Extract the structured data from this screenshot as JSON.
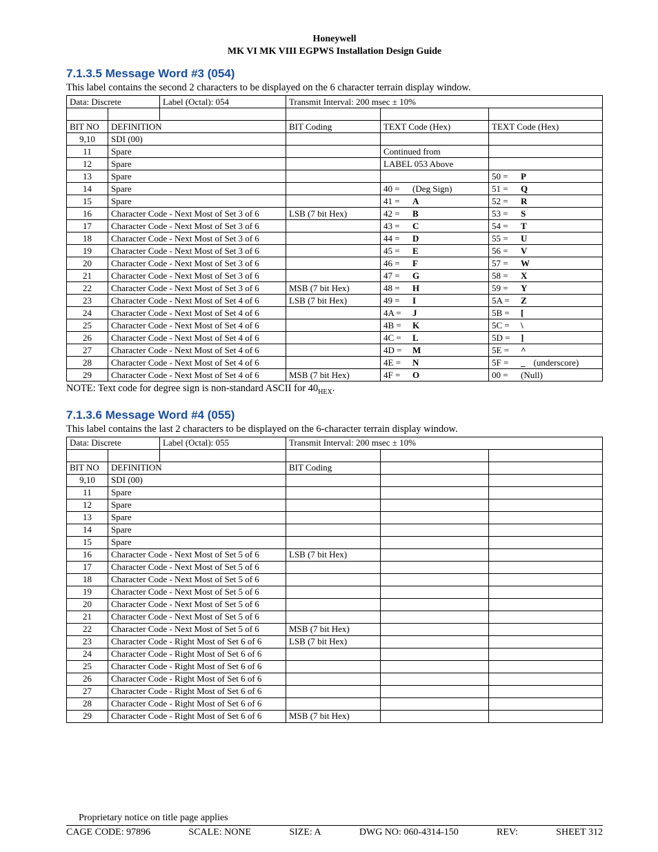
{
  "header": {
    "company": "Honeywell",
    "doc_title": "MK VI  MK VIII EGPWS Installation Design Guide"
  },
  "sections": [
    {
      "heading": "7.1.3.5  Message Word #3 (054)",
      "intro": "This label contains the second 2 characters to be displayed on the 6 character terrain display window.",
      "meta": {
        "data": "Data:  Discrete",
        "label_octal": "Label (Octal):  054",
        "tx_interval": "Transmit Interval:  200 msec ± 10%"
      },
      "head": {
        "bit_no": "BIT NO",
        "definition": "DEFINITION",
        "bit_coding": "BIT Coding",
        "tc1": "TEXT Code (Hex)",
        "tc2": "TEXT Code (Hex)"
      },
      "hex_intro_col4_a": "Continued from",
      "hex_intro_col4_b": "LABEL 053 Above",
      "rows": [
        {
          "bit": "9,10",
          "def": "SDI (00)",
          "coding": "",
          "c4": null,
          "c5": null
        },
        {
          "bit": "11",
          "def": "Spare",
          "coding": "",
          "c4": "__cont_a__",
          "c5": null
        },
        {
          "bit": "12",
          "def": "Spare",
          "coding": "",
          "c4": "__cont_b__",
          "c5": null
        },
        {
          "bit": "13",
          "def": "Spare",
          "coding": "",
          "c4": null,
          "c5": {
            "hex": "50 =",
            "ch": "P"
          }
        },
        {
          "bit": "14",
          "def": "Spare",
          "coding": "",
          "c4": {
            "hex": "40 =",
            "ch": "(Deg Sign)",
            "plain": true
          },
          "c5": {
            "hex": "51 =",
            "ch": "Q"
          }
        },
        {
          "bit": "15",
          "def": "Spare",
          "coding": "",
          "c4": {
            "hex": "41 =",
            "ch": "A"
          },
          "c5": {
            "hex": "52 =",
            "ch": "R"
          }
        },
        {
          "bit": "16",
          "def": "Character Code - Next Most of Set 3 of 6",
          "coding": "LSB (7 bit Hex)",
          "c4": {
            "hex": "42 =",
            "ch": "B"
          },
          "c5": {
            "hex": "53 =",
            "ch": "S"
          }
        },
        {
          "bit": "17",
          "def": "Character Code - Next Most of Set 3 of 6",
          "coding": "",
          "c4": {
            "hex": "43 =",
            "ch": "C"
          },
          "c5": {
            "hex": "54 =",
            "ch": "T"
          }
        },
        {
          "bit": "18",
          "def": "Character Code - Next Most of Set 3 of 6",
          "coding": "",
          "c4": {
            "hex": "44 =",
            "ch": "D"
          },
          "c5": {
            "hex": "55 =",
            "ch": "U"
          }
        },
        {
          "bit": "19",
          "def": "Character Code - Next Most of Set 3 of 6",
          "coding": "",
          "c4": {
            "hex": "45 =",
            "ch": "E"
          },
          "c5": {
            "hex": "56 =",
            "ch": "V"
          }
        },
        {
          "bit": "20",
          "def": "Character Code - Next Most of Set 3 of 6",
          "coding": "",
          "c4": {
            "hex": "46 =",
            "ch": "F"
          },
          "c5": {
            "hex": "57 =",
            "ch": "W"
          }
        },
        {
          "bit": "21",
          "def": "Character Code - Next Most of Set 3 of 6",
          "coding": "",
          "c4": {
            "hex": "47 =",
            "ch": "G"
          },
          "c5": {
            "hex": "58 =",
            "ch": "X"
          }
        },
        {
          "bit": "22",
          "def": "Character Code - Next Most of Set 3 of 6",
          "coding": "MSB (7 bit Hex)",
          "c4": {
            "hex": "48 =",
            "ch": "H"
          },
          "c5": {
            "hex": "59 =",
            "ch": "Y"
          }
        },
        {
          "bit": "23",
          "def": "Character Code - Next Most of Set 4 of 6",
          "coding": "LSB (7 bit Hex)",
          "c4": {
            "hex": "49 =",
            "ch": "I"
          },
          "c5": {
            "hex": "5A =",
            "ch": "Z"
          }
        },
        {
          "bit": "24",
          "def": "Character Code - Next Most of Set 4 of 6",
          "coding": "",
          "c4": {
            "hex": "4A =",
            "ch": "J"
          },
          "c5": {
            "hex": "5B =",
            "ch": "["
          }
        },
        {
          "bit": "25",
          "def": "Character Code - Next Most of Set 4 of 6",
          "coding": "",
          "c4": {
            "hex": "4B =",
            "ch": "K"
          },
          "c5": {
            "hex": "5C =",
            "ch": "\\"
          }
        },
        {
          "bit": "26",
          "def": "Character Code - Next Most of Set 4 of 6",
          "coding": "",
          "c4": {
            "hex": "4C =",
            "ch": "L"
          },
          "c5": {
            "hex": "5D =",
            "ch": "]"
          }
        },
        {
          "bit": "27",
          "def": "Character Code - Next Most of Set 4 of 6",
          "coding": "",
          "c4": {
            "hex": "4D =",
            "ch": "M"
          },
          "c5": {
            "hex": "5E =",
            "ch": "^"
          }
        },
        {
          "bit": "28",
          "def": "Character Code - Next Most of Set 4 of 6",
          "coding": "",
          "c4": {
            "hex": "4E =",
            "ch": "N"
          },
          "c5": {
            "hex": "5F =",
            "ch": "_",
            "desc": "(underscore)"
          }
        },
        {
          "bit": "29",
          "def": "Character Code - Next Most of Set 4 of 6",
          "coding": "MSB (7 bit Hex)",
          "c4": {
            "hex": "4F =",
            "ch": "O"
          },
          "c5": {
            "hex": "00 =",
            "ch": "(Null)",
            "plain": true
          }
        }
      ],
      "note": "NOTE:  Text code for degree sign is non-standard ASCII for 40",
      "note_sub": "HEX",
      "note_tail": "."
    },
    {
      "heading": "7.1.3.6  Message Word #4 (055)",
      "intro": "This label contains the last 2 characters to be displayed on the 6-character terrain display window.",
      "meta": {
        "data": "Data:  Discrete",
        "label_octal": "Label (Octal):  055",
        "tx_interval": "Transmit Interval:  200 msec ± 10%"
      },
      "head": {
        "bit_no": "BIT NO",
        "definition": "DEFINITION",
        "bit_coding": "BIT Coding",
        "tc1": "",
        "tc2": ""
      },
      "rows": [
        {
          "bit": "9,10",
          "def": "SDI (00)",
          "coding": ""
        },
        {
          "bit": "11",
          "def": "Spare",
          "coding": ""
        },
        {
          "bit": "12",
          "def": "Spare",
          "coding": ""
        },
        {
          "bit": "13",
          "def": "Spare",
          "coding": ""
        },
        {
          "bit": "14",
          "def": "Spare",
          "coding": ""
        },
        {
          "bit": "15",
          "def": "Spare",
          "coding": ""
        },
        {
          "bit": "16",
          "def": "Character Code - Next Most of Set 5 of 6",
          "coding": "LSB (7 bit Hex)"
        },
        {
          "bit": "17",
          "def": "Character Code - Next Most of Set 5 of 6",
          "coding": ""
        },
        {
          "bit": "18",
          "def": "Character Code - Next Most of Set 5 of 6",
          "coding": ""
        },
        {
          "bit": "19",
          "def": "Character Code - Next Most of Set 5 of 6",
          "coding": ""
        },
        {
          "bit": "20",
          "def": "Character Code - Next Most of Set 5 of 6",
          "coding": ""
        },
        {
          "bit": "21",
          "def": "Character Code - Next Most of Set 5 of 6",
          "coding": ""
        },
        {
          "bit": "22",
          "def": "Character Code - Next Most of Set 5 of 6",
          "coding": "MSB (7 bit Hex)"
        },
        {
          "bit": "23",
          "def": "Character Code - Right Most of Set 6 of 6",
          "coding": "LSB (7 bit Hex)"
        },
        {
          "bit": "24",
          "def": "Character Code - Right Most of Set 6 of 6",
          "coding": ""
        },
        {
          "bit": "25",
          "def": "Character Code - Right Most of Set 6 of 6",
          "coding": ""
        },
        {
          "bit": "26",
          "def": "Character Code - Right Most of Set 6 of 6",
          "coding": ""
        },
        {
          "bit": "27",
          "def": "Character Code - Right Most of Set 6 of 6",
          "coding": ""
        },
        {
          "bit": "28",
          "def": "Character Code - Right Most of Set 6 of 6",
          "coding": ""
        },
        {
          "bit": "29",
          "def": "Character Code - Right Most of Set 6 of 6",
          "coding": "MSB (7 bit Hex)"
        }
      ]
    }
  ],
  "footer": {
    "proprietary": "Proprietary notice on title page applies",
    "cage": "CAGE CODE: 97896",
    "scale": "SCALE: NONE",
    "size": "SIZE: A",
    "dwg": "DWG NO: 060-4314-150",
    "rev": "REV:",
    "sheet": "SHEET 312"
  }
}
